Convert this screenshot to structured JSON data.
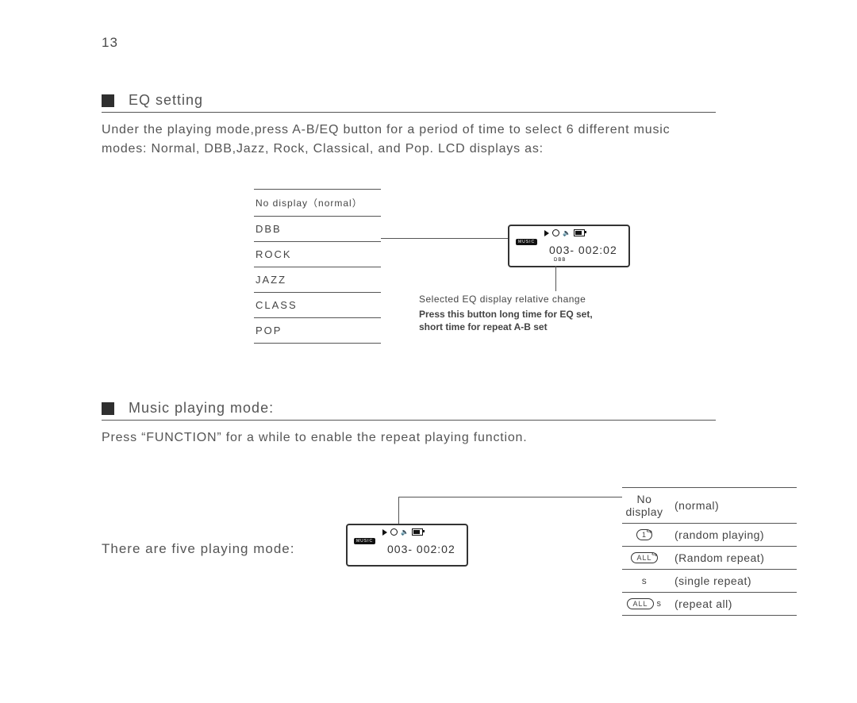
{
  "page_number": "13",
  "sections": {
    "eq": {
      "title": "EQ setting",
      "body": "Under the playing mode,press A-B/EQ button for a period of time to select 6 different music modes: Normal, DBB,Jazz, Rock, Classical, and Pop. LCD displays as:",
      "list": [
        "No display（normal）",
        "DBB",
        "ROCK",
        "JAZZ",
        "CLASS",
        "POP"
      ],
      "callout_line1": "Selected EQ display relative change",
      "callout_bold1": "Press this button long time for EQ set,",
      "callout_bold2": "short time for repeat A-B set"
    },
    "music": {
      "title": "Music playing mode:",
      "body": "Press “FUNCTION” for a while to enable the repeat playing function.",
      "five_modes": "There are five playing mode:"
    }
  },
  "lcd": {
    "music_badge": "MUSIC",
    "readout": "003- 002:02",
    "dbb_tag": "DBB"
  },
  "modes": [
    {
      "icon_text": "No display",
      "icon_kind": "text",
      "desc": "normal"
    },
    {
      "icon_text": "1",
      "icon_kind": "oval",
      "desc": "random playing"
    },
    {
      "icon_text": "ALL",
      "icon_kind": "oval",
      "desc": "Random repeat"
    },
    {
      "icon_text": "s",
      "icon_kind": "text_s",
      "desc": "single repeat"
    },
    {
      "icon_text": "ALL",
      "icon_kind": "oval_s",
      "desc": "repeat all"
    }
  ]
}
